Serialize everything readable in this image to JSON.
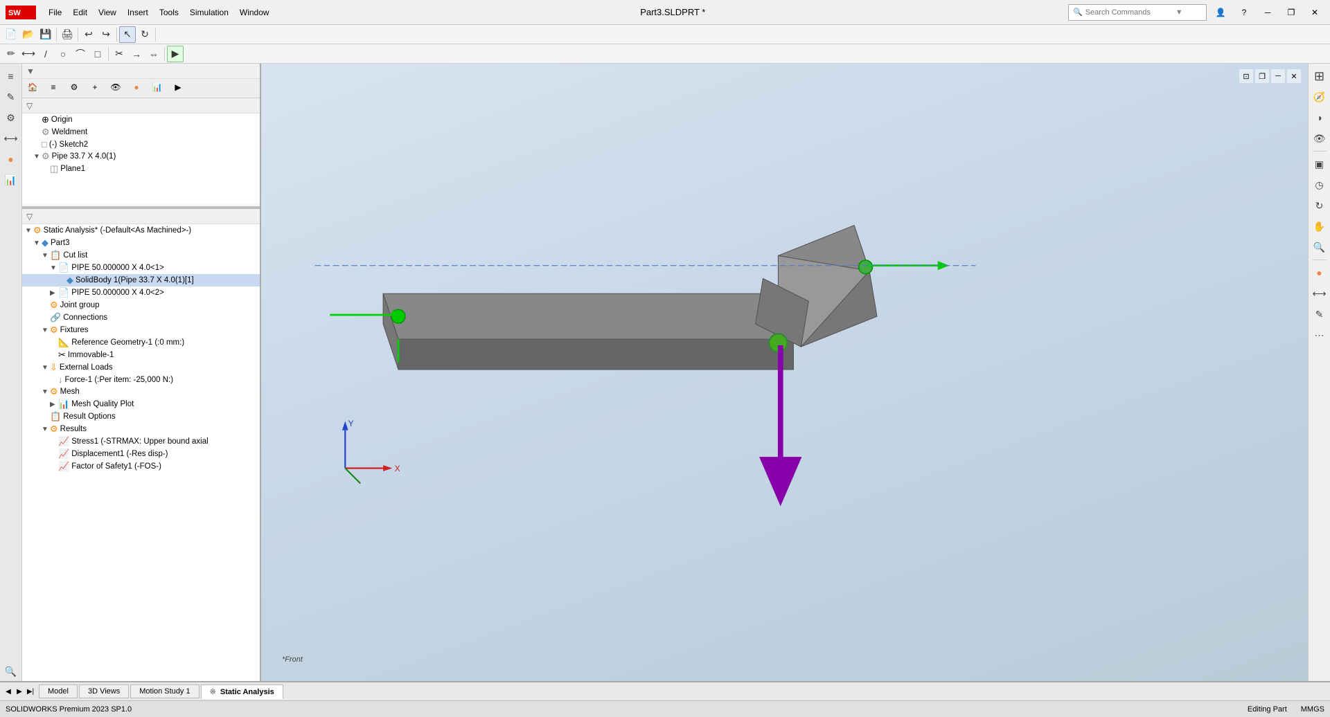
{
  "titlebar": {
    "app_name": "SOLIDWORKS",
    "file_name": "Part3.SLDPRT *",
    "search_placeholder": "Search Commands",
    "menu_items": [
      "File",
      "Edit",
      "View",
      "Insert",
      "Tools",
      "Simulation",
      "Window"
    ],
    "win_buttons": [
      "minimize",
      "restore",
      "close"
    ]
  },
  "tree": {
    "top_section": {
      "items": [
        {
          "label": "Origin",
          "icon": "⊕",
          "indent": 1,
          "expand": ""
        },
        {
          "label": "Weldment",
          "icon": "⚙",
          "indent": 1,
          "expand": ""
        },
        {
          "label": "(-) Sketch2",
          "icon": "□",
          "indent": 1,
          "expand": ""
        },
        {
          "label": "Pipe 33.7 X 4.0(1)",
          "icon": "🔩",
          "indent": 1,
          "expand": "▼"
        },
        {
          "label": "Plane1",
          "icon": "◫",
          "indent": 2,
          "expand": ""
        }
      ]
    },
    "sim_section": {
      "root": "Static Analysis* (-Default<As Machined>-)",
      "items": [
        {
          "label": "Part3",
          "icon": "🔷",
          "indent": 1,
          "expand": "▼"
        },
        {
          "label": "Cut list",
          "icon": "📋",
          "indent": 2,
          "expand": "▼"
        },
        {
          "label": "PIPE 50.000000 X 4.0<1>",
          "icon": "📄",
          "indent": 3,
          "expand": "▼"
        },
        {
          "label": "SolidBody 1(Pipe 33.7 X 4.0(1)[1]",
          "icon": "🔷",
          "indent": 4,
          "expand": ""
        },
        {
          "label": "PIPE 50.000000 X 4.0<2>",
          "icon": "📄",
          "indent": 3,
          "expand": "▶"
        },
        {
          "label": "Joint group",
          "icon": "⚙",
          "indent": 2,
          "expand": ""
        },
        {
          "label": "Connections",
          "icon": "🔗",
          "indent": 2,
          "expand": ""
        },
        {
          "label": "Fixtures",
          "icon": "⚙",
          "indent": 2,
          "expand": "▼"
        },
        {
          "label": "Reference Geometry-1 (:0 mm:)",
          "icon": "📐",
          "indent": 3,
          "expand": ""
        },
        {
          "label": "Immovable-1",
          "icon": "✂",
          "indent": 3,
          "expand": ""
        },
        {
          "label": "External Loads",
          "icon": "⇩",
          "indent": 2,
          "expand": "▼"
        },
        {
          "label": "Force-1 (:Per item: -25,000 N:)",
          "icon": "↓",
          "indent": 3,
          "expand": ""
        },
        {
          "label": "Mesh",
          "icon": "⚙",
          "indent": 2,
          "expand": "▼"
        },
        {
          "label": "Mesh Quality Plot",
          "icon": "📊",
          "indent": 3,
          "expand": "▶"
        },
        {
          "label": "Result Options",
          "icon": "📋",
          "indent": 2,
          "expand": ""
        },
        {
          "label": "Results",
          "icon": "⚙",
          "indent": 2,
          "expand": "▼"
        },
        {
          "label": "Stress1 (-STRMAX: Upper bound axial",
          "icon": "📈",
          "indent": 3,
          "expand": ""
        },
        {
          "label": "Displacement1 (-Res disp-)",
          "icon": "📈",
          "indent": 3,
          "expand": ""
        },
        {
          "label": "Factor of Safety1 (-FOS-)",
          "icon": "📈",
          "indent": 3,
          "expand": ""
        }
      ]
    }
  },
  "bottom_tabs": [
    {
      "label": "Model",
      "active": false
    },
    {
      "label": "3D Views",
      "active": false
    },
    {
      "label": "Motion Study 1",
      "active": false
    },
    {
      "label": "Static Analysis",
      "active": true
    }
  ],
  "statusbar": {
    "left": "SOLIDWORKS Premium 2023 SP1.0",
    "center": "Editing Part",
    "right": "MMGS"
  },
  "viewport": {
    "label": "*Front"
  }
}
